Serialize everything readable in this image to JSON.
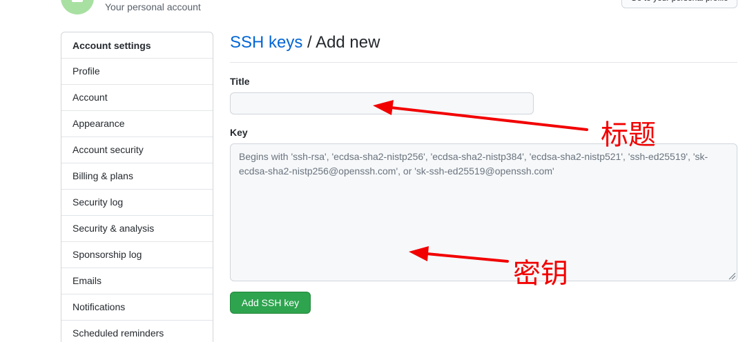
{
  "header": {
    "subtitle": "Your personal account",
    "goto_button": "Go to your personal profile"
  },
  "sidebar": {
    "heading": "Account settings",
    "items": [
      {
        "label": "Profile"
      },
      {
        "label": "Account"
      },
      {
        "label": "Appearance"
      },
      {
        "label": "Account security"
      },
      {
        "label": "Billing & plans"
      },
      {
        "label": "Security log"
      },
      {
        "label": "Security & analysis"
      },
      {
        "label": "Sponsorship log"
      },
      {
        "label": "Emails"
      },
      {
        "label": "Notifications"
      },
      {
        "label": "Scheduled reminders"
      }
    ]
  },
  "main": {
    "breadcrumb_link": "SSH keys",
    "breadcrumb_separator": " / ",
    "breadcrumb_current": "Add new",
    "title_label": "Title",
    "title_value": "",
    "key_label": "Key",
    "key_placeholder": "Begins with 'ssh-rsa', 'ecdsa-sha2-nistp256', 'ecdsa-sha2-nistp384', 'ecdsa-sha2-nistp521', 'ssh-ed25519', 'sk-ecdsa-sha2-nistp256@openssh.com', or 'sk-ssh-ed25519@openssh.com'",
    "submit_button": "Add SSH key"
  },
  "annotations": {
    "title_note": "标题",
    "key_note": "密钥"
  },
  "colors": {
    "link": "#0366d6",
    "primary_button": "#2ea44f",
    "annotation": "#f20000"
  }
}
